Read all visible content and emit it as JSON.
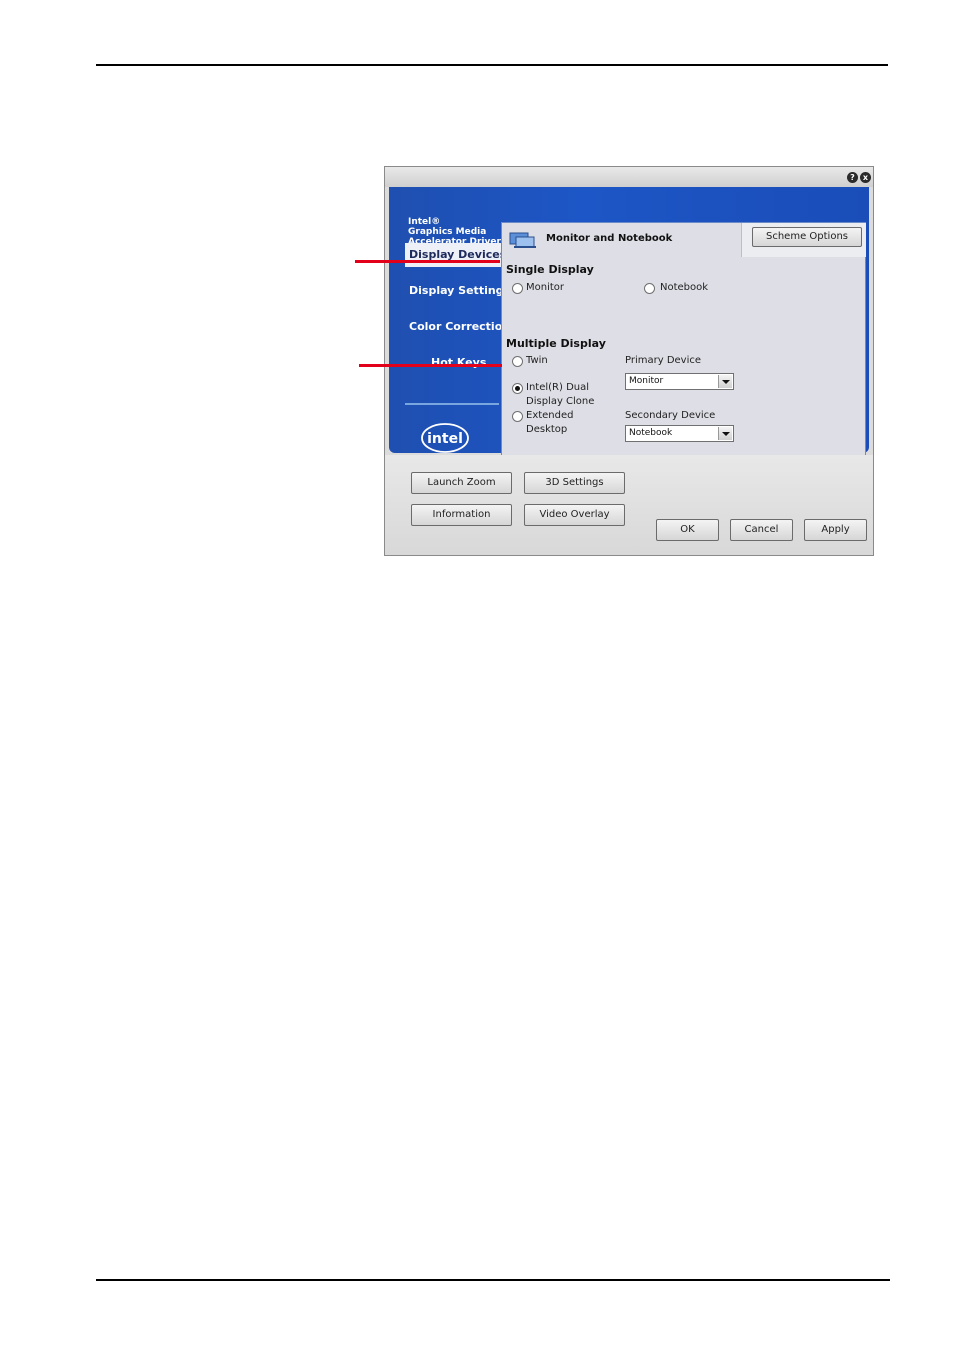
{
  "window": {
    "help_glyph": "?",
    "close_glyph": "x"
  },
  "brand": {
    "line1": "Intel®",
    "line2": "Graphics Media",
    "line3": "Accelerator Driver"
  },
  "nav": {
    "items": [
      {
        "label": "Display Devices",
        "active": true
      },
      {
        "label": "Display Settings",
        "active": false
      },
      {
        "label": "Color Correction",
        "active": false
      },
      {
        "label": "Hot Keys",
        "active": false
      }
    ]
  },
  "logo": {
    "text": "intel"
  },
  "panel": {
    "title": "Monitor and Notebook",
    "scheme_options": "Scheme Options",
    "single_display": {
      "heading": "Single Display",
      "options": [
        {
          "label": "Monitor",
          "checked": false
        },
        {
          "label": "Notebook",
          "checked": false
        }
      ]
    },
    "multiple_display": {
      "heading": "Multiple Display",
      "twin": "Twin",
      "dual_clone_line1": "Intel(R) Dual",
      "dual_clone_line2": "Display Clone",
      "extended_line1": "Extended",
      "extended_line2": "Desktop",
      "selected": "Intel(R) Dual Display Clone"
    },
    "primary_device": {
      "label": "Primary Device",
      "value": "Monitor"
    },
    "secondary_device": {
      "label": "Secondary Device",
      "value": "Notebook"
    }
  },
  "buttons": {
    "launch_zoom": "Launch Zoom",
    "settings_3d": "3D Settings",
    "information": "Information",
    "video_overlay": "Video Overlay",
    "ok": "OK",
    "cancel": "Cancel",
    "apply": "Apply"
  },
  "colors": {
    "accent_blue": "#1d56c6",
    "callout_red": "#e3001b"
  }
}
